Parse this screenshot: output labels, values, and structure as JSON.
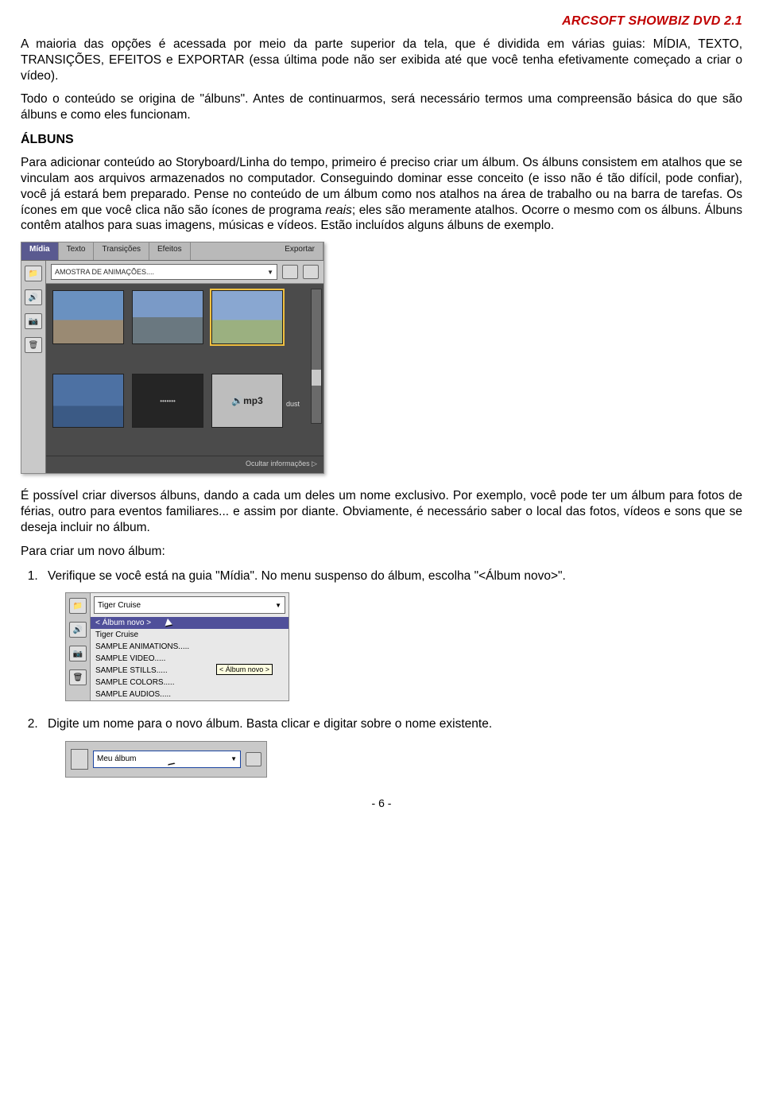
{
  "header": {
    "title": "ARCSOFT SHOWBIZ DVD 2.1"
  },
  "intro": {
    "p1": "A maioria das opções é acessada por meio da parte superior da tela, que é dividida em várias guias: MÍDIA, TEXTO, TRANSIÇÕES, EFEITOS e EXPORTAR (essa última pode não ser exibida até que você tenha efetivamente começado a criar o vídeo).",
    "p2": "Todo o conteúdo se origina de \"álbuns\". Antes de continuarmos, será necessário termos uma compreensão básica do que são álbuns e como eles funcionam."
  },
  "albuns": {
    "heading": "ÁLBUNS",
    "p1_a": "Para adicionar conteúdo ao Storyboard/Linha do tempo, primeiro é preciso criar um álbum. Os álbuns consistem em atalhos que se vinculam aos arquivos armazenados no computador. Conseguindo dominar esse conceito (e isso não é tão difícil, pode confiar), você já estará bem preparado. Pense no conteúdo de um álbum como nos atalhos na área de trabalho ou na barra de tarefas. Os ícones em que você clica não são ícones de programa ",
    "p1_b": "reais",
    "p1_c": "; eles são meramente atalhos. Ocorre o mesmo com os álbuns. Álbuns contêm atalhos para suas imagens, músicas e vídeos. Estão incluídos alguns álbuns de exemplo."
  },
  "panel1": {
    "tabs": [
      "Mídia",
      "Texto",
      "Transições",
      "Efeitos",
      "Exportar"
    ],
    "album_selected": "AMOSTRA DE ANIMAÇÕES....",
    "mp3_label": "mp3",
    "dust_label": "dust",
    "footer": "Ocultar informações"
  },
  "after1": {
    "p1": "É possível criar diversos álbuns, dando a cada um deles um nome exclusivo. Por exemplo, você pode ter um álbum para fotos de férias, outro para eventos familiares... e assim por diante. Obviamente, é necessário saber o local das fotos, vídeos e sons que se deseja incluir no álbum.",
    "p2": "Para criar um novo álbum:",
    "li1": "Verifique se você está na guia \"Mídia\". No menu suspenso do álbum, escolha \"<Álbum novo>\"."
  },
  "panel2": {
    "field": "Tiger Cruise",
    "items": [
      "< Álbum novo >",
      "Tiger Cruise",
      "SAMPLE ANIMATIONS.....",
      "SAMPLE VIDEO.....",
      "SAMPLE STILLS.....",
      "SAMPLE COLORS.....",
      "SAMPLE AUDIOS....."
    ],
    "tooltip": "< Álbum novo >"
  },
  "after2": {
    "li2": "Digite um nome para o novo álbum. Basta clicar e digitar sobre o nome existente."
  },
  "panel3": {
    "value": "Meu álbum"
  },
  "footer": {
    "page": "- 6 -"
  }
}
